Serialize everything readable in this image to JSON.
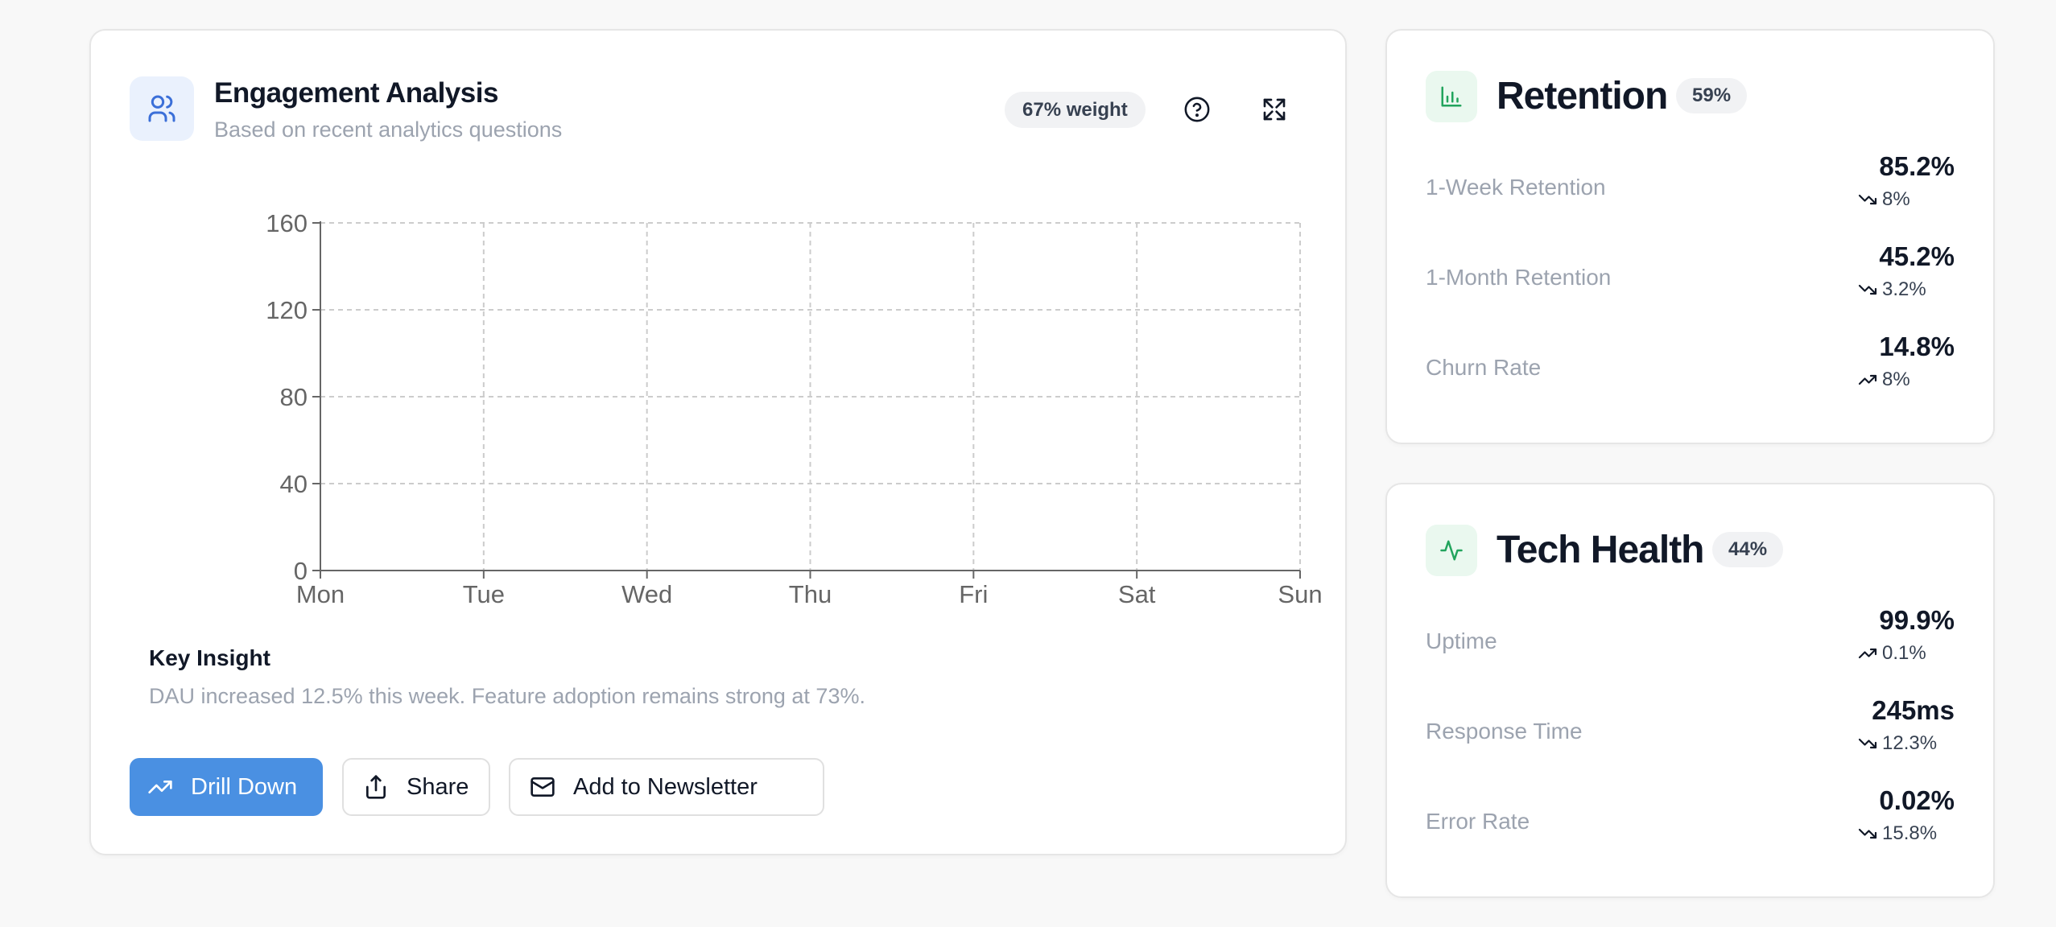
{
  "engagement": {
    "title": "Engagement Analysis",
    "subtitle": "Based on recent analytics questions",
    "weight_badge": "67% weight",
    "insight_title": "Key Insight",
    "insight_text": "DAU increased 12.5% this week. Feature adoption remains strong at 73%.",
    "buttons": {
      "drill_down": "Drill Down",
      "share": "Share",
      "newsletter": "Add to Newsletter"
    },
    "accent_color": "#4a90e2"
  },
  "chart_data": {
    "type": "line",
    "categories": [
      "Mon",
      "Tue",
      "Wed",
      "Thu",
      "Fri",
      "Sat",
      "Sun"
    ],
    "series": [],
    "yticks": [
      "0",
      "40",
      "80",
      "120",
      "160"
    ],
    "ylim": [
      0,
      160
    ],
    "grid": true,
    "title": "",
    "xlabel": "",
    "ylabel": ""
  },
  "retention": {
    "title": "Retention",
    "badge": "59%",
    "metrics": [
      {
        "label": "1-Week Retention",
        "value": "85.2%",
        "trend": "8%",
        "direction": "down"
      },
      {
        "label": "1-Month Retention",
        "value": "45.2%",
        "trend": "3.2%",
        "direction": "down"
      },
      {
        "label": "Churn Rate",
        "value": "14.8%",
        "trend": "8%",
        "direction": "up"
      }
    ]
  },
  "tech_health": {
    "title": "Tech Health",
    "badge": "44%",
    "metrics": [
      {
        "label": "Uptime",
        "value": "99.9%",
        "trend": "0.1%",
        "direction": "up"
      },
      {
        "label": "Response Time",
        "value": "245ms",
        "trend": "12.3%",
        "direction": "down"
      },
      {
        "label": "Error Rate",
        "value": "0.02%",
        "trend": "15.8%",
        "direction": "down"
      }
    ]
  }
}
